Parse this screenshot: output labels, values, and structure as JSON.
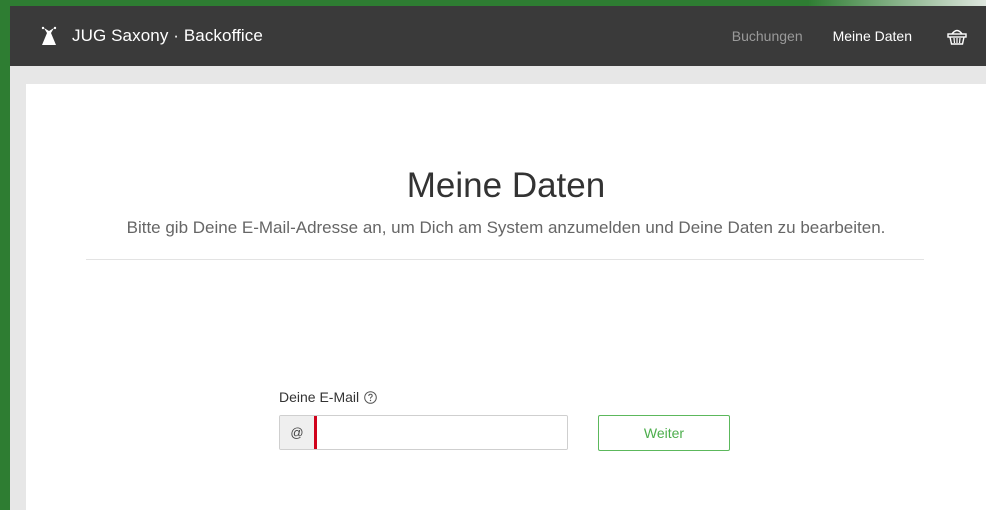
{
  "app": {
    "brand_title": "JUG Saxony · Backoffice"
  },
  "nav": {
    "items": [
      {
        "label": "Buchungen",
        "active": false
      },
      {
        "label": "Meine Daten",
        "active": true
      }
    ],
    "basket_icon": "basket-icon"
  },
  "main": {
    "title": "Meine Daten",
    "subtitle": "Bitte gib Deine E-Mail-Adresse an, um Dich am System anzumelden und Deine Daten zu bearbeiten."
  },
  "form": {
    "email_label": "Deine E-Mail",
    "help_icon": "help-icon",
    "addon_symbol": "@",
    "email_value": "",
    "email_placeholder": "",
    "submit_label": "Weiter"
  },
  "colors": {
    "navbar_bg": "#3a3a3a",
    "accent_green": "#5cb85c",
    "error_red": "#d0021b",
    "frame_green": "#2e7d32"
  }
}
